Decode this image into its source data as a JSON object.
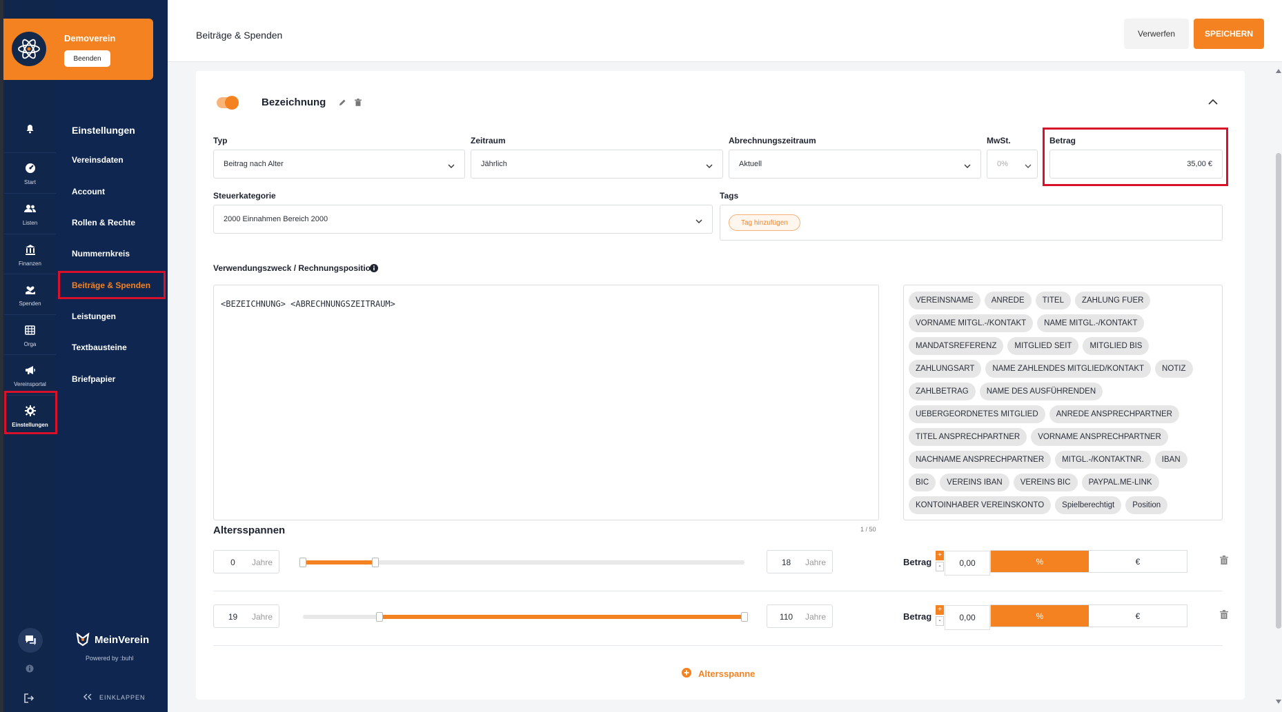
{
  "club": {
    "name": "Demoverein",
    "end_button": "Beenden"
  },
  "rail": {
    "items": [
      {
        "label": "",
        "icon": "bell-icon"
      },
      {
        "label": "Start",
        "icon": "dashboard-icon"
      },
      {
        "label": "Listen",
        "icon": "users-icon"
      },
      {
        "label": "Finanzen",
        "icon": "bank-icon"
      },
      {
        "label": "Spenden",
        "icon": "donation-icon"
      },
      {
        "label": "Orga",
        "icon": "calendar-icon"
      },
      {
        "label": "Vereinsportal",
        "icon": "megaphone-icon"
      },
      {
        "label": "Einstellungen",
        "icon": "gear-icon"
      }
    ]
  },
  "nav": {
    "heading": "Einstellungen",
    "items": [
      "Vereinsdaten",
      "Account",
      "Rollen & Rechte",
      "Nummernkreis",
      "Beiträge & Spenden",
      "Leistungen",
      "Textbausteine",
      "Briefpapier"
    ],
    "active": "Beiträge & Spenden",
    "brand": "MeinVerein",
    "powered_by": "Powered by :buhl",
    "collapse": "EINKLAPPEN"
  },
  "header": {
    "title": "Beiträge & Spenden",
    "discard": "Verwerfen",
    "save": "SPEICHERN"
  },
  "form": {
    "name": "Bezeichnung",
    "active": true,
    "typ": {
      "label": "Typ",
      "value": "Beitrag nach Alter"
    },
    "zeitraum": {
      "label": "Zeitraum",
      "value": "Jährlich"
    },
    "abrechnungszeitraum": {
      "label": "Abrechnungszeitraum",
      "value": "Aktuell"
    },
    "mwst": {
      "label": "MwSt.",
      "value": "0%"
    },
    "betrag": {
      "label": "Betrag",
      "value": "35,00 €"
    },
    "steuerkategorie": {
      "label": "Steuerkategorie",
      "value": "2000 Einnahmen Bereich 2000"
    },
    "tags": {
      "label": "Tags",
      "add": "Tag hinzufügen"
    },
    "purpose": {
      "label": "Verwendungszweck / Rechnungsposition",
      "value": "<BEZEICHNUNG> <ABRECHNUNGSZEITRAUM>",
      "count": "1 / 50"
    },
    "placeholders": [
      "VEREINSNAME",
      "ANREDE",
      "TITEL",
      "ZAHLUNG FUER",
      "VORNAME MITGL.-/KONTAKT",
      "NAME MITGL.-/KONTAKT",
      "MANDATSREFERENZ",
      "MITGLIED SEIT",
      "MITGLIED BIS",
      "ZAHLUNGSART",
      "NAME ZAHLENDES MITGLIED/KONTAKT",
      "NOTIZ",
      "ZAHLBETRAG",
      "NAME DES AUSFÜHRENDEN",
      "UEBERGEORDNETES MITGLIED",
      "ANREDE ANSPRECHPARTNER",
      "TITEL ANSPRECHPARTNER",
      "VORNAME ANSPRECHPARTNER",
      "NACHNAME ANSPRECHPARTNER",
      "MITGL.-/KONTAKTNR.",
      "IBAN",
      "BIC",
      "VEREINS IBAN",
      "VEREINS BIC",
      "PAYPAL.ME-LINK",
      "KONTOINHABER VEREINSKONTO",
      "Spielberechtigt",
      "Position"
    ]
  },
  "age_ranges": {
    "title": "Altersspannen",
    "unit": "Jahre",
    "betrag_label": "Betrag",
    "percent": "%",
    "euro": "€",
    "plus": "+",
    "minus": "-",
    "slider_max": 110,
    "rows": [
      {
        "from": "0",
        "to": "18",
        "amount": "0,00",
        "mode": "%"
      },
      {
        "from": "19",
        "to": "110",
        "amount": "0,00",
        "mode": "%"
      }
    ],
    "add": "Altersspanne"
  },
  "colors": {
    "accent": "#f58220",
    "sidebar": "#0f2750",
    "highlight": "#d9102a"
  }
}
